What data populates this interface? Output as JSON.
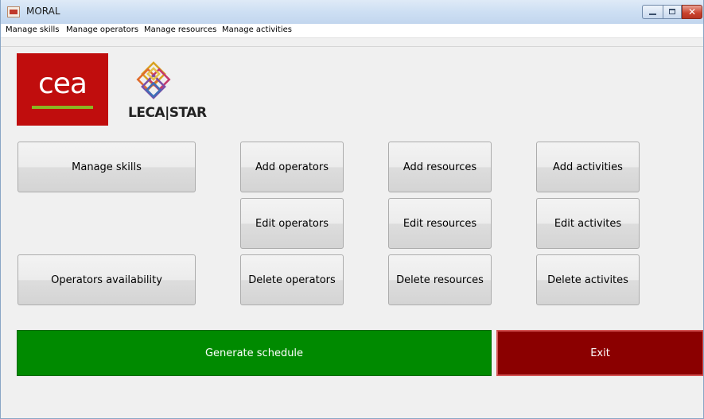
{
  "window": {
    "title": "MORAL",
    "icon": "app-icon",
    "controls": {
      "minimize": "minimize-icon",
      "maximize": "maximize-icon",
      "close": "✕"
    }
  },
  "menubar": {
    "items": [
      {
        "label": "Manage skills"
      },
      {
        "label": "Manage operators"
      },
      {
        "label": "Manage resources"
      },
      {
        "label": "Manage activities"
      }
    ]
  },
  "logos": {
    "cea": {
      "text": "cea",
      "bg_color": "#c00d0d",
      "bar_color": "#8bb522"
    },
    "leca": {
      "text": "LECA|STAR"
    }
  },
  "buttons": {
    "manage_skills": "Manage skills",
    "operators_availability": "Operators availability",
    "add_operators": "Add operators",
    "edit_operators": "Edit operators",
    "delete_operators": "Delete operators",
    "add_resources": "Add resources",
    "edit_resources": "Edit resources",
    "delete_resources": "Delete resources",
    "add_activities": "Add activities",
    "edit_activites": "Edit activites",
    "delete_activites": "Delete activites",
    "generate_schedule": "Generate schedule",
    "exit": "Exit"
  },
  "colors": {
    "generate": "#008a00",
    "exit": "#8b0000"
  }
}
